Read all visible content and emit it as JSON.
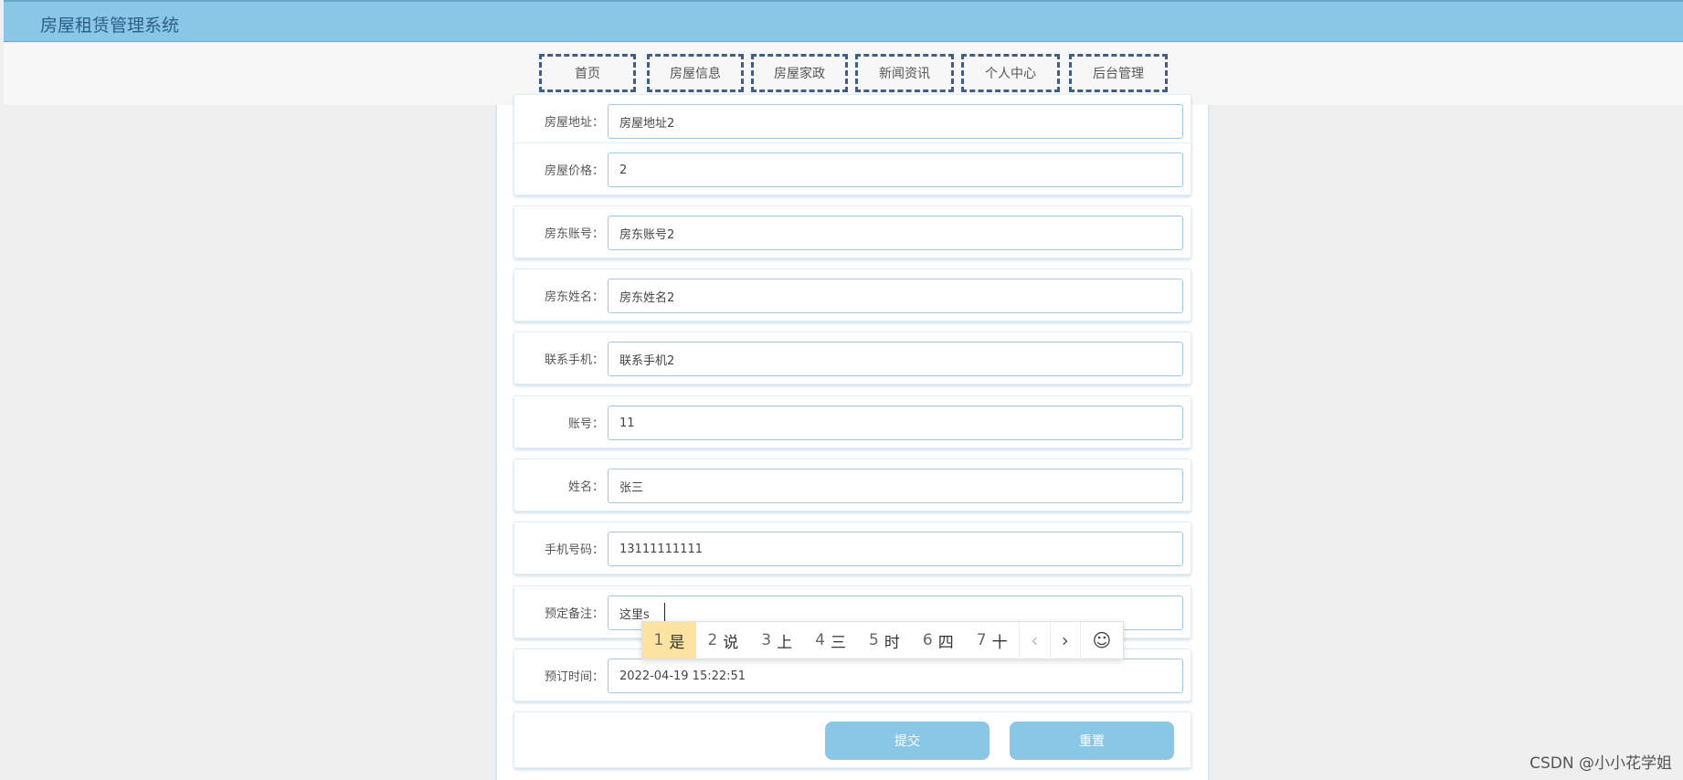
{
  "app": {
    "title": "房屋租赁管理系统"
  },
  "nav": [
    {
      "label": "首页"
    },
    {
      "label": "房屋信息"
    },
    {
      "label": "房屋家政"
    },
    {
      "label": "新闻资讯"
    },
    {
      "label": "个人中心"
    },
    {
      "label": "后台管理"
    }
  ],
  "form": {
    "fields": [
      {
        "label": "房屋地址：",
        "value": "房屋地址2"
      },
      {
        "label": "房屋价格：",
        "value": "2"
      },
      {
        "label": "房东账号：",
        "value": "房东账号2"
      },
      {
        "label": "房东姓名：",
        "value": "房东姓名2"
      },
      {
        "label": "联系手机：",
        "value": "联系手机2"
      },
      {
        "label": "账号：",
        "value": "11"
      },
      {
        "label": "姓名：",
        "value": "张三"
      },
      {
        "label": "手机号码：",
        "value": "13111111111"
      },
      {
        "label": "预定备注：",
        "value": "这里s"
      },
      {
        "label": "预订时间：",
        "value": "2022-04-19 15:22:51"
      }
    ],
    "submit_label": "提交",
    "reset_label": "重置"
  },
  "ime": {
    "candidates": [
      {
        "num": "1",
        "text": "是"
      },
      {
        "num": "2",
        "text": "说"
      },
      {
        "num": "3",
        "text": "上"
      },
      {
        "num": "4",
        "text": "三"
      },
      {
        "num": "5",
        "text": "时"
      },
      {
        "num": "6",
        "text": "四"
      },
      {
        "num": "7",
        "text": "十"
      }
    ],
    "prev": "‹",
    "next": "›",
    "emoji": "☺"
  },
  "watermark": "CSDN @小小花学姐",
  "colors": {
    "accent": "#8ac6e6",
    "nav_border": "#3f5d8c",
    "ime_active": "#fde3a0"
  }
}
